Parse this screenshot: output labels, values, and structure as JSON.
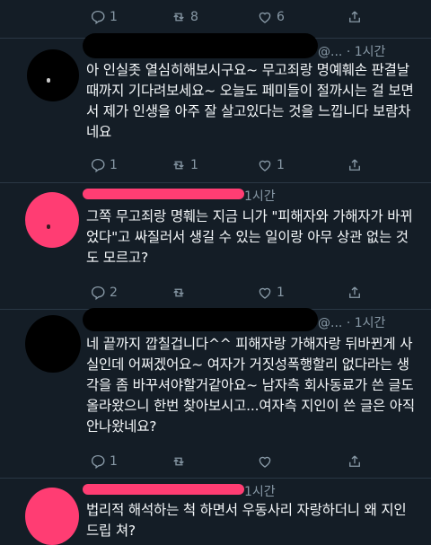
{
  "top_actions": {
    "reply": "1",
    "retweet": "8",
    "like": "6"
  },
  "tweets": [
    {
      "meta_user": "@...",
      "meta_time": "· 1시간",
      "text": "아 인실좃 열심히해보시구요~ 무고죄랑 명예훼손 판결날때까지 기다려보세요~ 오늘도 페미들이 절까시는 걸 보면서 제가 인생을 아주 잘 살고있다는 것을 느낍니다 보람차네요",
      "reply": "1",
      "retweet": "1",
      "like": "1"
    },
    {
      "meta_user": "",
      "meta_time": "1시간",
      "text": "그쪽 무고죄랑 명훼는 지금 니가 \"피해자와 가해자가 바뀌었다\"고 싸질러서 생길 수 있는 일이랑 아무 상관 없는 것도 모르고?",
      "reply": "2",
      "retweet": "",
      "like": "1"
    },
    {
      "meta_user": "@...",
      "meta_time": "· 1시간",
      "text": "네 끝까지 깝칠겁니다^^ 피해자랑 가해자랑 뒤바뀐게 사실인데 어쩌겠어요~ 여자가 거짓성폭행할리 없다라는 생각을 좀 바꾸셔야할거같아요~ 남자측 회사동료가 쓴 글도 올라왔으니 한번 찾아보시고...여자측 지인이 쓴 글은 아직 안나왔네요?",
      "reply": "1",
      "retweet": "",
      "like": ""
    },
    {
      "meta_user": "",
      "meta_time": "1시간",
      "text": "법리적 해석하는 척 하면서 우동사리 자랑하더니 왜 지인 드립 쳐?"
    }
  ]
}
